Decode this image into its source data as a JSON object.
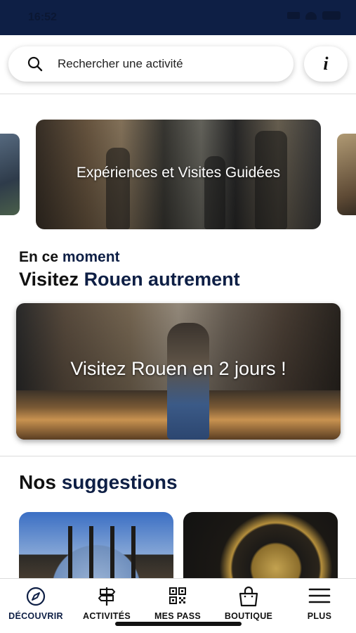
{
  "status_bar": {
    "time": "16:52"
  },
  "search": {
    "placeholder": "Rechercher une activité",
    "info_label": "i"
  },
  "carousel": {
    "title": "Expériences et Visites Guidées"
  },
  "moment": {
    "kicker_plain": "En ce ",
    "kicker_accent": "moment",
    "title_plain": "Visitez ",
    "title_accent": "Rouen autrement",
    "card_title": "Visitez Rouen en 2 jours !"
  },
  "suggestions": {
    "title_plain": "Nos ",
    "title_accent": "suggestions"
  },
  "bottom_nav": {
    "items": [
      {
        "label": "DÉCOUVRIR",
        "icon": "compass-icon",
        "active": true
      },
      {
        "label": "ACTIVITÉS",
        "icon": "signpost-icon",
        "active": false
      },
      {
        "label": "MES PASS",
        "icon": "qr-code-icon",
        "active": false
      },
      {
        "label": "BOUTIQUE",
        "icon": "shopping-bag-icon",
        "active": false
      },
      {
        "label": "PLUS",
        "icon": "menu-icon",
        "active": false
      }
    ]
  },
  "colors": {
    "accent": "#0e1f45",
    "status_bar": "#0e1f45",
    "text": "#111111"
  }
}
